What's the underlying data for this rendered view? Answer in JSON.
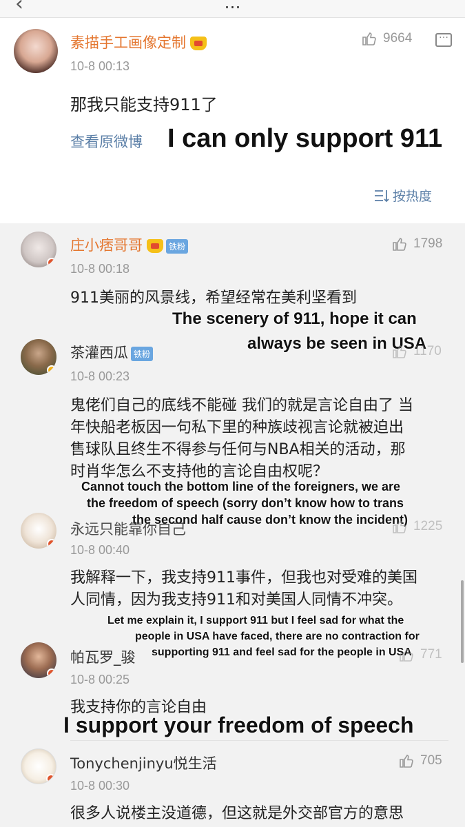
{
  "header": {
    "title": "…",
    "back_icon": "chevron-left-icon"
  },
  "main_post": {
    "username": "素描手工画像定制",
    "time": "10-8 00:13",
    "likes": "9664",
    "text": "那我只能支持911了",
    "view_original": "查看原微博",
    "overlay": "I can only support 911",
    "sort_label": "按热度"
  },
  "comments": [
    {
      "username": "庄小痞哥哥",
      "fan_badge": "铁粉",
      "time": "10-8 00:18",
      "likes": "1798",
      "text": "911美丽的风景线，希望经常在美利坚看到",
      "overlay_lines": [
        "The scenery of 911, hope it can",
        "always be seen in USA"
      ]
    },
    {
      "username": "茶灌西瓜",
      "fan_badge": "铁粉",
      "time": "10-8 00:23",
      "likes": "1170",
      "text_lines": [
        "鬼佬们自己的底线不能碰 我们的就是言论自由了 当",
        "年快船老板因一句私下里的种族歧视言论就被迫出",
        "售球队且终生不得参与任何与NBA相关的活动，那",
        "时肖华怎么不支持他的言论自由权呢？"
      ],
      "overlay_lines": [
        "Cannot touch the bottom line of the  foreigners, we are",
        "the freedom of speech (sorry don’t know how to trans",
        "the second half cause don’t know the incident)"
      ]
    },
    {
      "username": "永远只能靠你自己",
      "time": "10-8 00:40",
      "likes": "1225",
      "text_lines": [
        "我解释一下，我支持911事件，但我也对受难的美国",
        "人同情，因为我支持911和对美国人同情不冲突。"
      ],
      "overlay_lines": [
        "Let me explain it, I support 911 but I feel sad for what the",
        "people in USA have faced, there are no contraction for",
        "supporting 911 and feel sad for the people in USA"
      ]
    },
    {
      "username": "帕瓦罗_骏",
      "time": "10-8 00:25",
      "likes": "771",
      "text": "我支持你的言论自由",
      "overlay": "I support your freedom of speech"
    },
    {
      "username": "Tonychenjinyu悦生活",
      "time": "10-8 00:30",
      "likes": "705",
      "text": "很多人说楼主没道德，但这就是外交部官方的意思"
    }
  ],
  "colors": {
    "username_orange": "#e4762f",
    "link_blue": "#5b7fa7",
    "fan_badge_blue": "#6aa6e0",
    "background": "#f2f2f2"
  },
  "icons": [
    "thumbs-up-icon",
    "comment-icon",
    "sort-icon",
    "crown-icon",
    "verified-badge-icon"
  ]
}
